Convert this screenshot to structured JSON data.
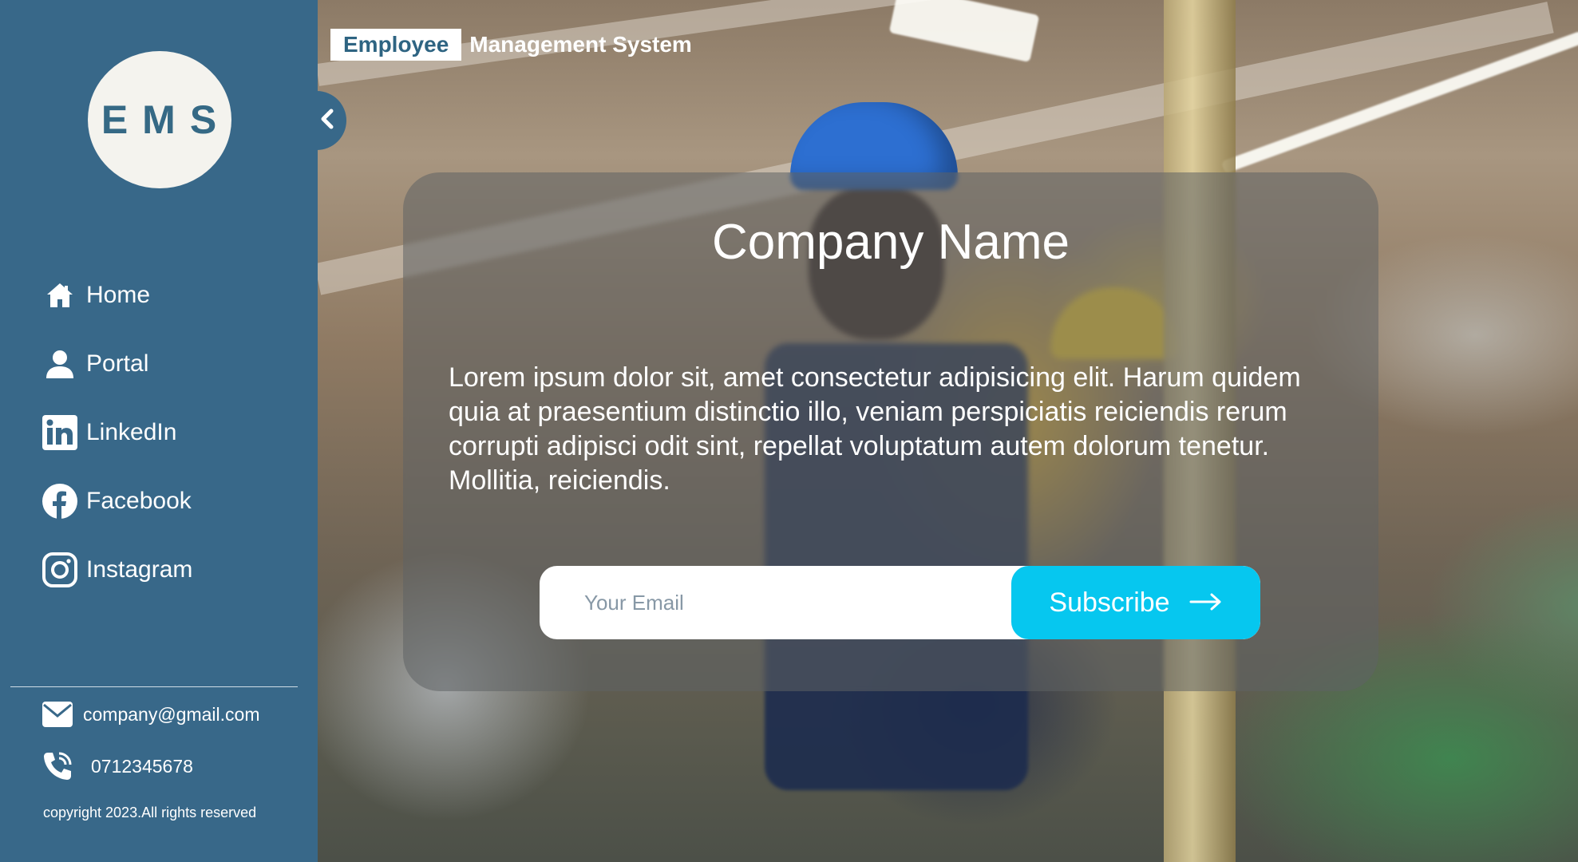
{
  "brand": {
    "highlight": "Employee",
    "rest": "Management System"
  },
  "logo": {
    "text": "EMS"
  },
  "sidebar": {
    "items": [
      {
        "label": "Home",
        "icon": "home-icon"
      },
      {
        "label": "Portal",
        "icon": "user-icon"
      },
      {
        "label": "LinkedIn",
        "icon": "linkedin-icon"
      },
      {
        "label": "Facebook",
        "icon": "facebook-icon"
      },
      {
        "label": "Instagram",
        "icon": "instagram-icon"
      }
    ],
    "contact": {
      "email": "company@gmail.com",
      "phone": "0712345678"
    },
    "copyright": "copyright 2023.All rights reserved"
  },
  "card": {
    "title": "Company Name",
    "text": "Lorem ipsum dolor sit, amet consectetur adipisicing elit. Harum quidem quia at praesentium distinctio illo, veniam perspiciatis reiciendis rerum corrupti adipisci odit sint, repellat voluptatum autem dolorum tenetur. Mollitia, reiciendis.",
    "email_placeholder": "Your Email",
    "subscribe_label": "Subscribe"
  },
  "colors": {
    "sidebar": "#386889",
    "accent": "#06c7ef",
    "logo_bg": "#f4f3ee"
  }
}
